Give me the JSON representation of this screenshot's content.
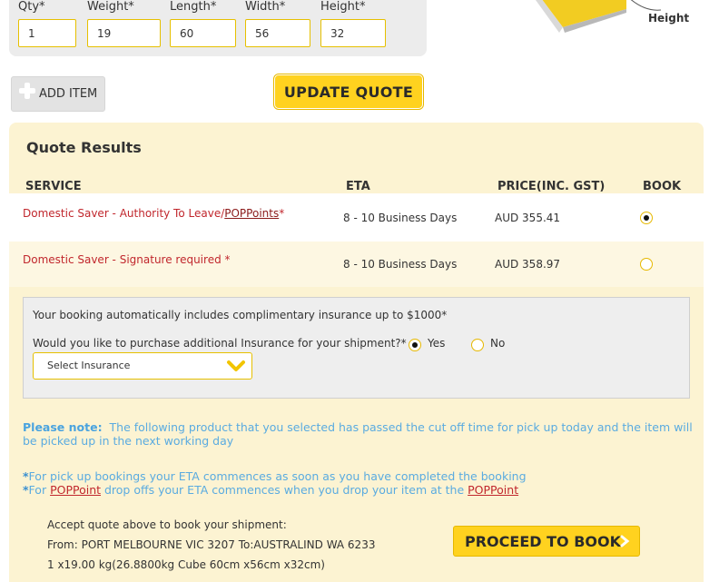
{
  "form": {
    "qty_label": "Qty*",
    "weight_label": "Weight*",
    "length_label": "Length*",
    "width_label": "Width*",
    "height_label": "Height*",
    "qty_value": "1",
    "weight_value": "19",
    "length_value": "60",
    "width_value": "56",
    "height_value": "32"
  },
  "diagram": {
    "height_label": "Height"
  },
  "actions": {
    "add_item_label": "ADD ITEM",
    "update_quote_label": "UPDATE QUOTE"
  },
  "quote": {
    "title": "Quote Results",
    "columns": {
      "service": "SERVICE",
      "eta": "ETA",
      "price": "PRICE(INC. GST)",
      "book": "BOOK"
    },
    "rows": [
      {
        "service_prefix": "Domestic Saver - Authority To Leave/",
        "service_link": "POPPoints",
        "service_suffix": "*",
        "eta": "8 - 10 Business Days",
        "price": "AUD 355.41",
        "selected": true
      },
      {
        "service_prefix": "Domestic Saver - Signature required *",
        "service_link": "",
        "service_suffix": "",
        "eta": "8 - 10 Business Days",
        "price": "AUD 358.97",
        "selected": false
      }
    ]
  },
  "insurance": {
    "included_text": "Your booking automatically includes complimentary insurance up to $1000*",
    "question": "Would you like to purchase additional Insurance for your shipment?*",
    "yes_label": "Yes",
    "no_label": "No",
    "selected": "Yes",
    "select_placeholder": "Select Insurance"
  },
  "notice": {
    "label": "Please note:",
    "text": "The following product that you selected has passed the cut off time for pick up today and the item will be picked up in the next working day"
  },
  "footnotes": {
    "star": "*",
    "line1": "For pick up bookings your ETA commences as soon as you have completed the booking",
    "line2_prefix": "For ",
    "line2_link1": "POPPoint",
    "line2_middle": " drop offs your ETA commences when you drop your item at the ",
    "line2_link2": "POPPoint"
  },
  "summary": {
    "accept_text": "Accept quote above to book your shipment:",
    "route": "From: PORT MELBOURNE VIC 3207 To:AUSTRALIND WA 6233",
    "item": "1 x19.00 kg(26.8800kg Cube 60cm x56cm x32cm)"
  },
  "proceed_label": "PROCEED TO BOOK",
  "colors": {
    "accent": "#ffd21f",
    "panel": "#fcf3d2",
    "service_red": "#c1272d",
    "note_blue": "#5aabe0"
  }
}
